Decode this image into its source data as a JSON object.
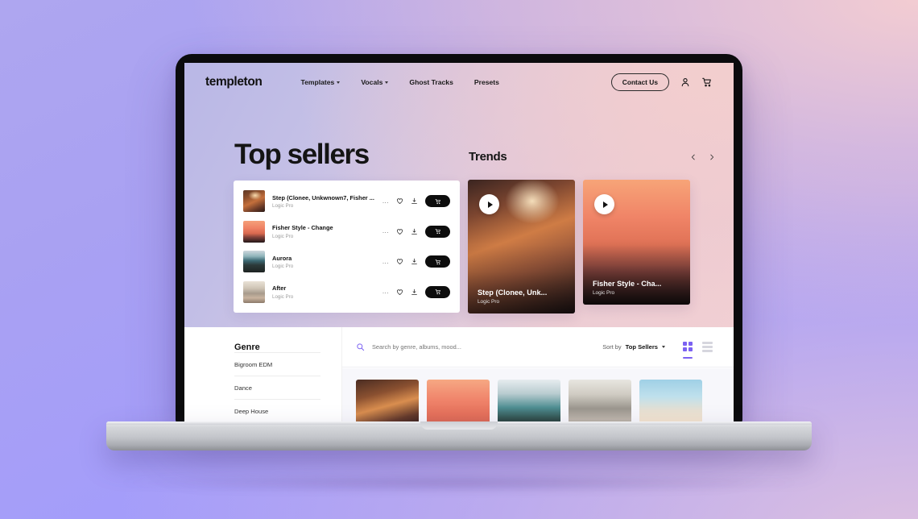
{
  "site": {
    "logo": "templeton",
    "nav_links": [
      {
        "label": "Templates",
        "has_caret": true
      },
      {
        "label": "Vocals",
        "has_caret": true
      },
      {
        "label": "Ghost Tracks",
        "has_caret": false
      },
      {
        "label": "Presets",
        "has_caret": false
      }
    ],
    "contact_label": "Contact Us",
    "account_icon": "user-icon",
    "cart_icon": "cart-icon"
  },
  "hero": {
    "top_sellers_heading": "Top sellers",
    "tracks": [
      {
        "title": "Step (Clonee, Unkwnown7, Fisher ...",
        "subtitle": "Logic Pro",
        "thumb_class": "img-step0"
      },
      {
        "title": "Fisher Style - Change",
        "subtitle": "Logic Pro",
        "thumb_class": "img-fisher0"
      },
      {
        "title": "Aurora",
        "subtitle": "Logic Pro",
        "thumb_class": "img-aurora"
      },
      {
        "title": "After",
        "subtitle": "Logic Pro",
        "thumb_class": "img-after"
      }
    ],
    "row_icons": {
      "more": "...",
      "favorite": "heart-icon",
      "download": "download-icon",
      "cart": "cart-icon"
    },
    "trends_heading": "Trends",
    "prev_icon": "chevron-left-icon",
    "next_icon": "chevron-right-icon",
    "trend_cards": [
      {
        "title": "Step (Clonee, Unk...",
        "subtitle": "Logic Pro",
        "image_class": "img-step1",
        "play_icon": "play-icon"
      },
      {
        "title": "Fisher Style - Cha...",
        "subtitle": "Logic Pro",
        "image_class": "img-fisher1",
        "play_icon": "play-icon"
      }
    ]
  },
  "catalog": {
    "genre_heading": "Genre",
    "genres": [
      "Bigroom EDM",
      "Dance",
      "Deep House"
    ],
    "search_placeholder": "Search by genre, albums, mood...",
    "search_value": "",
    "search_icon": "search-icon",
    "sort_label": "Sort by",
    "sort_value": "Top Sellers",
    "grid_view_icon": "grid-view-icon",
    "list_view_icon": "list-view-icon",
    "active_view": "grid",
    "accent_color": "#7b61f2",
    "results": [
      {
        "image_class": "img-g0"
      },
      {
        "image_class": "img-g1"
      },
      {
        "image_class": "img-g2"
      },
      {
        "image_class": "img-g3"
      },
      {
        "image_class": "img-g4"
      }
    ]
  }
}
